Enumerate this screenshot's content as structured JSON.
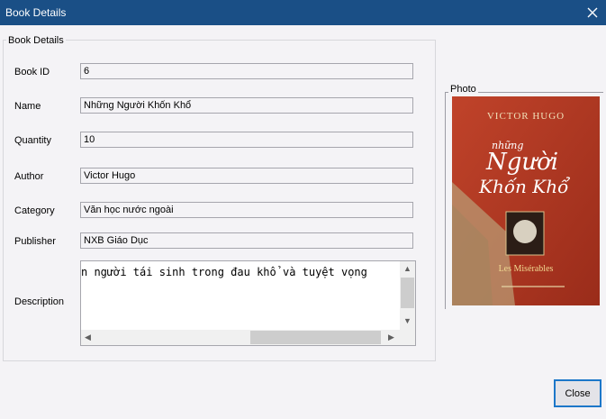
{
  "window": {
    "title": "Book Details"
  },
  "details_group": {
    "title": "Book Details"
  },
  "fields": {
    "book_id": {
      "label": "Book ID",
      "value": "6"
    },
    "name": {
      "label": "Name",
      "value": "Những Người Khốn Khổ"
    },
    "quantity": {
      "label": "Quantity",
      "value": "10"
    },
    "author": {
      "label": "Author",
      "value": "Victor Hugo"
    },
    "category": {
      "label": "Category",
      "value": "Văn học nước ngoài"
    },
    "publisher": {
      "label": "Publisher",
      "value": "NXB Giáo Dục"
    },
    "description": {
      "label": "Description",
      "value": "n người tái sinh trong đau khổ và tuyệt vọng"
    }
  },
  "photo_group": {
    "title": "Photo",
    "cover": {
      "author": "VICTOR HUGO",
      "title_line1": "những",
      "title_line2": "Người",
      "title_line3": "Khốn Khổ",
      "subtitle": "Les Misérables"
    }
  },
  "buttons": {
    "close": "Close"
  }
}
